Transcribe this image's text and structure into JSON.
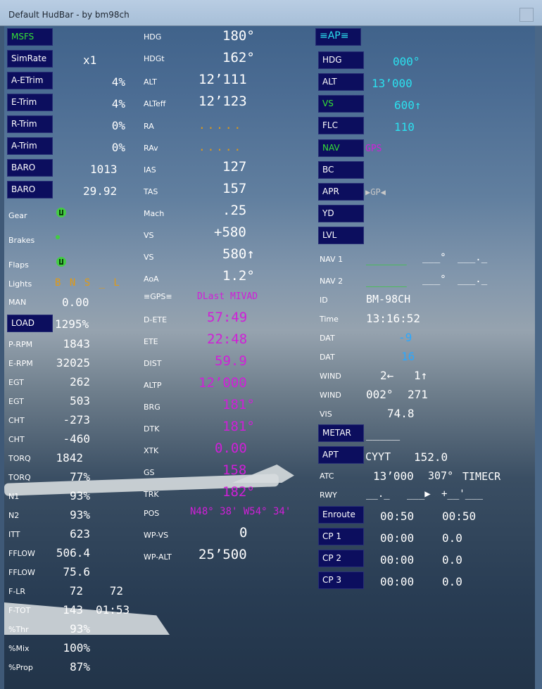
{
  "window": {
    "title": "Default HudBar - by bm98ch"
  },
  "left": {
    "msfs": "MSFS",
    "simrate_btn": "SimRate",
    "simrate": "x1",
    "aetrim_btn": "A-ETrim",
    "aetrim": "4%",
    "etrim_btn": "E-Trim",
    "etrim": "4%",
    "rtrim_btn": "R-Trim",
    "rtrim": "0%",
    "atrim_btn": "A-Trim",
    "atrim": "0%",
    "baro1_btn": "BARO",
    "baro1": "1013",
    "baro2_btn": "BARO",
    "baro2": "29.92",
    "gear": "Gear",
    "brakes": "Brakes",
    "flaps": "Flaps",
    "lights": "Lights",
    "lights_val": "B N S _ L",
    "man": "MAN",
    "man_val": "0.00",
    "load_btn": "LOAD",
    "load": "1295%",
    "prpm": "P-RPM",
    "prpm_val": "1843",
    "erpm": "E-RPM",
    "erpm_val": "32025",
    "egt1": "EGT",
    "egt1_val": "262",
    "egt2": "EGT",
    "egt2_val": "503",
    "cht1": "CHT",
    "cht1_val": "-273",
    "cht2": "CHT",
    "cht2_val": "-460",
    "torq1": "TORQ",
    "torq1_val": "1842",
    "torq2": "TORQ",
    "torq2_val": "77%",
    "n1": "N1",
    "n1_val": "93%",
    "n2": "N2",
    "n2_val": "93%",
    "itt": "ITT",
    "itt_val": "623",
    "ff1": "FFLOW",
    "ff1_val": "506.4",
    "ff2": "FFLOW",
    "ff2_val": "75.6",
    "flr": "F-LR",
    "flr_l": "72",
    "flr_r": "72",
    "ftot": "F-TOT",
    "ftot_val": "143",
    "ftot_time": "01:53",
    "thr": "%Thr",
    "thr_val": "93%",
    "mix": "%Mix",
    "mix_val": "100%",
    "prop": "%Prop",
    "prop_val": "87%"
  },
  "middle": {
    "hdg": "HDG",
    "hdg_val": "180°",
    "hdgt": "HDGt",
    "hdgt_val": "162°",
    "alt": "ALT",
    "alt_val": "12’111",
    "alteff": "ALTeff",
    "alteff_val": "12’123",
    "ra": "RA",
    "ra_val": ".....",
    "rav": "RAv",
    "rav_val": ".....",
    "ias": "IAS",
    "ias_val": "127",
    "tas": "TAS",
    "tas_val": "157",
    "mach": "Mach",
    "mach_val": ".25",
    "vs1": "VS",
    "vs1_val": "+580",
    "vs2": "VS",
    "vs2_val": "580↑",
    "aoa": "AoA",
    "aoa_val": "1.2°",
    "gps": "≡GPS≡",
    "gps_val": "DLast MIVAD",
    "dete": "D-ETE",
    "dete_val": "57:49",
    "ete": "ETE",
    "ete_val": "22:48",
    "dist": "DIST",
    "dist_val": "59.9",
    "altp": "ALTP",
    "altp_val": "12’000",
    "brg": "BRG",
    "brg_val": "181°",
    "dtk": "DTK",
    "dtk_val": "181°",
    "xtk": "XTK",
    "xtk_val": "0.00",
    "gs": "GS",
    "gs_val": "158",
    "trk": "TRK",
    "trk_val": "182°",
    "pos": "POS",
    "pos_val": "N48° 38' W54° 34'",
    "wpvs": "WP-VS",
    "wpvs_val": "0",
    "wpalt": "WP-ALT",
    "wpalt_val": "25’500"
  },
  "right": {
    "ap_btn": "≡AP≡",
    "hdg_btn": "HDG",
    "hdg_val": "000°",
    "alt_btn": "ALT",
    "alt_val": "13’000",
    "vs_btn": "VS",
    "vs_val": "600↑",
    "flc_btn": "FLC",
    "flc_val": "110",
    "nav_btn": "NAV",
    "nav_val": "GPS",
    "bc_btn": "BC",
    "apr_btn": "APR",
    "apr_val": "▶GP◀",
    "yd_btn": "YD",
    "lvl_btn": "LVL",
    "nav1": "NAV 1",
    "nav1_dash": "______",
    "nav1_crs": "___°",
    "nav1_dme": "___._",
    "nav2": "NAV 2",
    "nav2_dash": "______",
    "nav2_crs": "___°",
    "nav2_dme": "___._",
    "id": "ID",
    "id_val": "BM-98CH",
    "time": "Time",
    "time_val": "13:16:52",
    "dat1": "DAT",
    "dat1_val": "-9",
    "dat2": "DAT",
    "dat2_val": "16",
    "wind1": "WIND",
    "wind1_a": "2←",
    "wind1_b": "1↑",
    "wind2": "WIND",
    "wind2_a": "002°",
    "wind2_b": "271",
    "vis": "VIS",
    "vis_val": "74.8",
    "metar_btn": "METAR",
    "metar_val": "_____",
    "apt_btn": "APT",
    "apt_id": "CYYT",
    "apt_freq": "152.0",
    "atc": "ATC",
    "atc_alt": "13’000",
    "atc_hdg": "307°",
    "atc_id": "TIMECR",
    "rwy": "RWY",
    "rwy_a": "__._",
    "rwy_b": "___▶",
    "rwy_c": "+__'___",
    "enroute_btn": "Enroute",
    "enroute_a": "00:50",
    "enroute_b": "00:50",
    "cp1_btn": "CP 1",
    "cp1_a": "00:00",
    "cp1_b": "0.0",
    "cp2_btn": "CP 2",
    "cp2_a": "00:00",
    "cp2_b": "0.0",
    "cp3_btn": "CP 3",
    "cp3_a": "00:00",
    "cp3_b": "0.0"
  },
  "colors": {
    "button_bg": "#0c0e5e",
    "cyan": "#2be1ef",
    "magenta": "#d01fd8",
    "orange": "#e09a16",
    "green": "#36e236"
  }
}
